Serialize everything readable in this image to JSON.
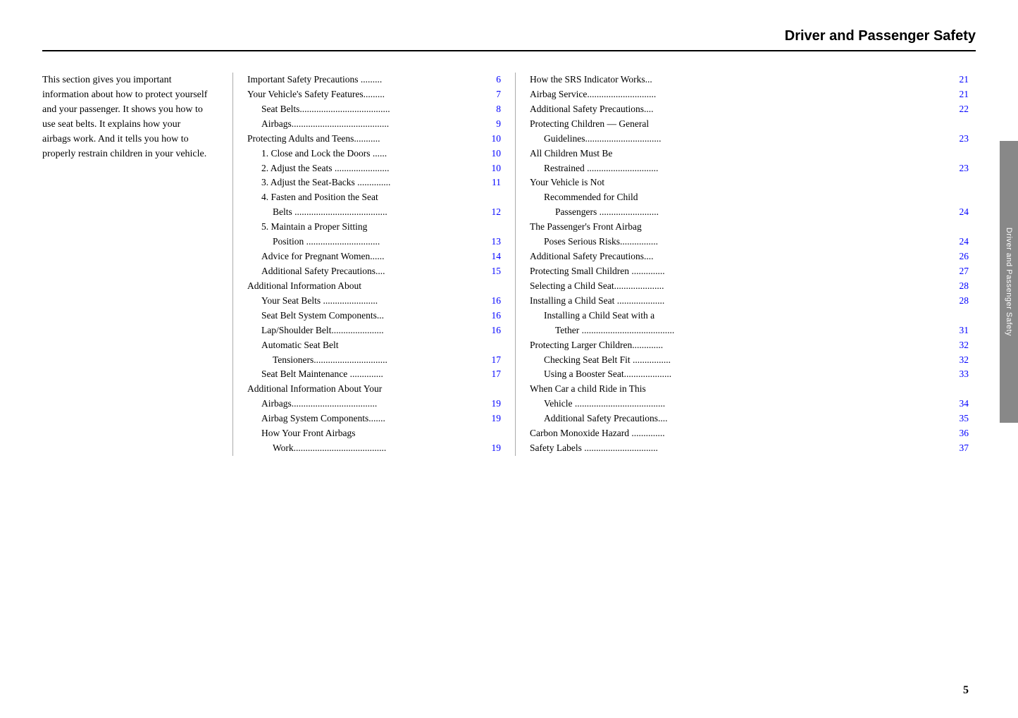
{
  "header": {
    "title": "Driver and Passenger Safety"
  },
  "intro": {
    "text": "This section gives you important information about how to protect yourself and your passenger. It shows you how to use seat belts. It explains how your airbags work. And it tells you how to properly restrain children in your vehicle."
  },
  "toc_middle": [
    {
      "text": "Important Safety Precautions .........",
      "page": "6",
      "indent": 0,
      "bold": false
    },
    {
      "text": "Your Vehicle's Safety Features.........",
      "page": "7",
      "indent": 0,
      "bold": false
    },
    {
      "text": "Seat Belts......................................",
      "page": "8",
      "indent": 1,
      "bold": false
    },
    {
      "text": "Airbags.........................................",
      "page": "9",
      "indent": 1,
      "bold": false
    },
    {
      "text": "Protecting Adults and Teens...........",
      "page": "10",
      "indent": 0,
      "bold": false
    },
    {
      "text": "1. Close and Lock the Doors ......",
      "page": "10",
      "indent": 1,
      "bold": false
    },
    {
      "text": "2. Adjust the Seats .......................",
      "page": "10",
      "indent": 1,
      "bold": false
    },
    {
      "text": "3. Adjust the Seat-Backs ..............",
      "page": "11",
      "indent": 1,
      "bold": false
    },
    {
      "text": "4. Fasten and Position the Seat",
      "page": "",
      "indent": 1,
      "bold": false
    },
    {
      "text": "Belts .......................................",
      "page": "12",
      "indent": 2,
      "bold": false
    },
    {
      "text": "5. Maintain a Proper Sitting",
      "page": "",
      "indent": 1,
      "bold": false
    },
    {
      "text": "Position ...............................",
      "page": "13",
      "indent": 2,
      "bold": false
    },
    {
      "text": "Advice for Pregnant Women......",
      "page": "14",
      "indent": 1,
      "bold": false
    },
    {
      "text": "Additional Safety Precautions....",
      "page": "15",
      "indent": 1,
      "bold": false
    },
    {
      "text": "Additional Information About",
      "page": "",
      "indent": 0,
      "bold": false
    },
    {
      "text": "Your Seat Belts .......................",
      "page": "16",
      "indent": 1,
      "bold": false
    },
    {
      "text": "Seat Belt System Components...",
      "page": "16",
      "indent": 1,
      "bold": false
    },
    {
      "text": "Lap/Shoulder Belt......................",
      "page": "16",
      "indent": 1,
      "bold": false
    },
    {
      "text": "Automatic Seat Belt",
      "page": "",
      "indent": 1,
      "bold": false
    },
    {
      "text": "Tensioners...............................",
      "page": "17",
      "indent": 2,
      "bold": false
    },
    {
      "text": "Seat Belt Maintenance ..............",
      "page": "17",
      "indent": 1,
      "bold": false
    },
    {
      "text": "Additional Information About Your",
      "page": "",
      "indent": 0,
      "bold": false
    },
    {
      "text": "Airbags....................................",
      "page": "19",
      "indent": 1,
      "bold": false
    },
    {
      "text": "Airbag System Components.......",
      "page": "19",
      "indent": 1,
      "bold": false
    },
    {
      "text": "How Your Front Airbags",
      "page": "",
      "indent": 1,
      "bold": false
    },
    {
      "text": "Work.......................................",
      "page": "19",
      "indent": 2,
      "bold": false
    }
  ],
  "toc_right": [
    {
      "text": "How the SRS Indicator Works...",
      "page": "21",
      "indent": 0,
      "bold": false
    },
    {
      "text": "Airbag Service.............................",
      "page": "21",
      "indent": 0,
      "bold": false
    },
    {
      "text": "Additional Safety Precautions....",
      "page": "22",
      "indent": 0,
      "bold": false
    },
    {
      "text": "Protecting Children — General",
      "page": "",
      "indent": 0,
      "bold": false
    },
    {
      "text": "Guidelines................................",
      "page": "23",
      "indent": 1,
      "bold": false
    },
    {
      "text": "All Children Must Be",
      "page": "",
      "indent": 0,
      "bold": false
    },
    {
      "text": "Restrained ..............................",
      "page": "23",
      "indent": 1,
      "bold": false
    },
    {
      "text": "Your Vehicle is Not",
      "page": "",
      "indent": 0,
      "bold": false
    },
    {
      "text": "Recommended for Child",
      "page": "",
      "indent": 1,
      "bold": false
    },
    {
      "text": "Passengers .........................",
      "page": "24",
      "indent": 2,
      "bold": false
    },
    {
      "text": "The Passenger's Front Airbag",
      "page": "",
      "indent": 0,
      "bold": false
    },
    {
      "text": "Poses Serious Risks................",
      "page": "24",
      "indent": 1,
      "bold": false
    },
    {
      "text": "Additional Safety Precautions....",
      "page": "26",
      "indent": 0,
      "bold": false
    },
    {
      "text": "Protecting Small Children ..............",
      "page": "27",
      "indent": 0,
      "bold": false
    },
    {
      "text": "Selecting a Child Seat.....................",
      "page": "28",
      "indent": 0,
      "bold": false
    },
    {
      "text": "Installing a Child Seat ....................",
      "page": "28",
      "indent": 0,
      "bold": false
    },
    {
      "text": "Installing a Child Seat with a",
      "page": "",
      "indent": 1,
      "bold": false
    },
    {
      "text": "Tether .......................................",
      "page": "31",
      "indent": 2,
      "bold": false
    },
    {
      "text": "Protecting Larger Children.............",
      "page": "32",
      "indent": 0,
      "bold": false
    },
    {
      "text": "Checking Seat Belt Fit ................",
      "page": "32",
      "indent": 1,
      "bold": false
    },
    {
      "text": "Using a Booster Seat....................",
      "page": "33",
      "indent": 1,
      "bold": false
    },
    {
      "text": "When Car a child Ride in This",
      "page": "",
      "indent": 0,
      "bold": false
    },
    {
      "text": "Vehicle ......................................",
      "page": "34",
      "indent": 1,
      "bold": false
    },
    {
      "text": "Additional Safety Precautions....",
      "page": "35",
      "indent": 1,
      "bold": false
    },
    {
      "text": "Carbon Monoxide Hazard ..............",
      "page": "36",
      "indent": 0,
      "bold": false
    },
    {
      "text": "Safety Labels ...............................",
      "page": "37",
      "indent": 0,
      "bold": false
    }
  ],
  "side_label": "Driver and Passenger Safety",
  "page_number": "5"
}
